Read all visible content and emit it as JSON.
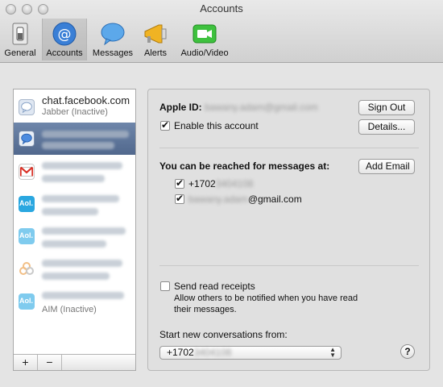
{
  "window": {
    "title": "Accounts"
  },
  "toolbar": {
    "items": [
      {
        "label": "General",
        "icon": "general-switch-icon",
        "selected": false
      },
      {
        "label": "Accounts",
        "icon": "at-sign-icon",
        "selected": true
      },
      {
        "label": "Messages",
        "icon": "speech-bubble-icon",
        "selected": false
      },
      {
        "label": "Alerts",
        "icon": "megaphone-icon",
        "selected": false
      },
      {
        "label": "Audio/Video",
        "icon": "video-camera-icon",
        "selected": false
      }
    ]
  },
  "accounts": {
    "rows": [
      {
        "name": "chat.facebook.com",
        "status": "Jabber (Inactive)",
        "icon": "chat-bubble-icon",
        "selected": false
      },
      {
        "name": "",
        "status": "",
        "icon": "chat-bubble-icon",
        "selected": true
      },
      {
        "name": "",
        "status": "",
        "icon": "gmail-icon",
        "selected": false
      },
      {
        "name": "",
        "status": "",
        "icon": "aol-icon",
        "selected": false
      },
      {
        "name": "",
        "status": "",
        "icon": "aol-icon",
        "selected": false
      },
      {
        "name": "",
        "status": "",
        "icon": "jabber-icon",
        "selected": false
      },
      {
        "name": "",
        "status": "AIM (Inactive)",
        "icon": "aol-icon",
        "selected": false
      }
    ],
    "add_label": "+",
    "remove_label": "−",
    "aol_text": "Aol."
  },
  "detail": {
    "apple_id_label": "Apple ID:",
    "apple_id_value": "bawany.adam@gmail.com",
    "sign_out_label": "Sign Out",
    "enable_label": "Enable this account",
    "enable_checked": true,
    "details_label": "Details...",
    "reach_label": "You can be reached for messages at:",
    "add_email_label": "Add Email",
    "reach_items": [
      {
        "prefix": "+1702",
        "hidden": "3404108",
        "suffix": "",
        "checked": true
      },
      {
        "prefix": "",
        "hidden": "bawany.adam",
        "suffix": "@gmail.com",
        "checked": true
      }
    ],
    "receipts_label": "Send read receipts",
    "receipts_checked": false,
    "receipts_desc_line1": "Allow others to be notified when you have read",
    "receipts_desc_line2": "their messages.",
    "start_label": "Start new conversations from:",
    "start_prefix": "+1702",
    "start_hidden": "3404108",
    "help_label": "?"
  },
  "colors": {
    "accent_selected": "#5a7196",
    "aol_blue": "#2aa7e0"
  }
}
